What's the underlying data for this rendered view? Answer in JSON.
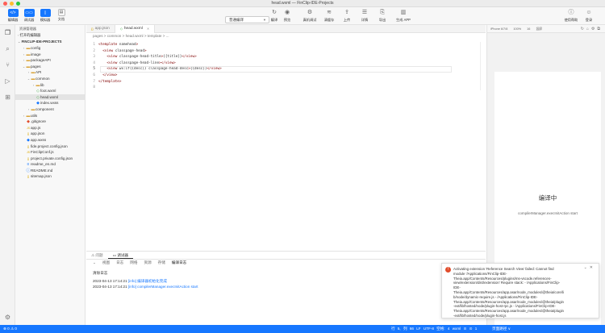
{
  "window": {
    "title": "head.wxml — FinClip-IDE-Projects"
  },
  "toolbar": {
    "left": [
      {
        "label": "编辑器",
        "icon": "</>"
      },
      {
        "label": "调试器",
        "icon": "▭▭"
      },
      {
        "label": "模拟器",
        "icon": "▯"
      },
      {
        "label": "文档",
        "icon": "▤"
      }
    ],
    "mode_select": "普通编译",
    "center": [
      {
        "label": "编译",
        "icon": "↻"
      },
      {
        "label": "预览",
        "icon": "◉"
      },
      {
        "label": "真机调试",
        "icon": "⚙"
      },
      {
        "label": "清缓存",
        "icon": "≋"
      },
      {
        "label": "上传",
        "icon": "⇪"
      },
      {
        "label": "详情",
        "icon": "☰"
      },
      {
        "label": "导出",
        "icon": "⎘"
      },
      {
        "label": "生成 APP",
        "icon": "▥"
      }
    ],
    "right": [
      {
        "label": "使用帮助",
        "icon": "ⓘ"
      },
      {
        "label": "登录",
        "icon": "☺"
      }
    ]
  },
  "explorer": {
    "title": "资源管理器",
    "open_editors": "打开的编辑器",
    "project": "FINCLIP-IDE-PROJECTS",
    "items": [
      {
        "label": "config",
        "depth": 1,
        "kind": "folder",
        "open": false
      },
      {
        "label": "image",
        "depth": 1,
        "kind": "folder",
        "open": false
      },
      {
        "label": "packageAPI",
        "depth": 1,
        "kind": "folder",
        "open": false
      },
      {
        "label": "pages",
        "depth": 1,
        "kind": "folder",
        "open": true
      },
      {
        "label": "API",
        "depth": 2,
        "kind": "folder",
        "open": false
      },
      {
        "label": "common",
        "depth": 2,
        "kind": "folder",
        "open": true
      },
      {
        "label": "lib",
        "depth": 3,
        "kind": "folder",
        "open": false
      },
      {
        "label": "foot.wxml",
        "depth": 3,
        "kind": "wxml"
      },
      {
        "label": "head.wxml",
        "depth": 3,
        "kind": "wxml"
      },
      {
        "label": "index.wxss",
        "depth": 3,
        "kind": "wxss"
      },
      {
        "label": "component",
        "depth": 2,
        "kind": "folder",
        "open": false
      },
      {
        "label": "utils",
        "depth": 1,
        "kind": "folder",
        "open": false
      },
      {
        "label": ".gitignore",
        "depth": 1,
        "kind": "git"
      },
      {
        "label": "app.js",
        "depth": 1,
        "kind": "js"
      },
      {
        "label": "app.json",
        "depth": 1,
        "kind": "json"
      },
      {
        "label": "app.wxss",
        "depth": 1,
        "kind": "wxss"
      },
      {
        "label": "fide.project.config.json",
        "depth": 1,
        "kind": "json"
      },
      {
        "label": "FinClipConf.js",
        "depth": 1,
        "kind": "js"
      },
      {
        "label": "project.private.config.json",
        "depth": 1,
        "kind": "json"
      },
      {
        "label": "readme_en.md",
        "depth": 1,
        "kind": "md"
      },
      {
        "label": "README.md",
        "depth": 1,
        "kind": "info"
      },
      {
        "label": "sitemap.json",
        "depth": 1,
        "kind": "json"
      }
    ]
  },
  "tabs": [
    {
      "label": "app.json",
      "active": false
    },
    {
      "label": "head.wxml",
      "active": true
    }
  ],
  "breadcrumb": "pages  >  common  >  head.wxml  >  template  >  ...",
  "code_lines": [
    "<template name=\"head\">",
    "  <view class=\"page-head\">",
    "    <view class=\"page-head-title\">{{title}}</view>",
    "    <view class=\"page-head-line\"></view>",
    "    <view wx:if=\"{{desc}}\" class=\"page-head-desc\">{{desc}}</view>",
    "  </view>",
    "</template>",
    ""
  ],
  "preview": {
    "device": "iPhone 6/7/8",
    "zoom": "100%",
    "scale": "16",
    "mode": "竖屏",
    "compiling": "编译中",
    "compiling_sub": "compilerManager.execInitAction start"
  },
  "panel": {
    "tabs": [
      "问题",
      "调试器"
    ],
    "subtabs": [
      "视图",
      "日志",
      "网络",
      "资源",
      "存储",
      "编译日志"
    ],
    "active_subtab": "编译日志",
    "log_title": "清除日志",
    "logs": [
      {
        "time": "2023-04-13 17:14:21",
        "text": " [info] 编译器初始化完成"
      },
      {
        "time": "2023-04-13 17:14:21",
        "text": " [info] compilerManager.execInitAction start"
      }
    ]
  },
  "toast": {
    "message": [
      "Activating extension 'Reference Search View' failed: Cannot find",
      "module '/Applications/FinClip-IDE-",
      "Theia.app/Contents/Resources/plugins/ms-vscode.references-",
      "view/extension/dist/extension' Require stack: - /Applications/FinClip-",
      "IDE-",
      "Theia.app/Contents/Resources/app.asar/node_modules/@theia/core/li",
      "b/node/dynamic-require.js - /Applications/FinClip-IDE-",
      "Theia.app/Contents/Resources/app.asar/node_modules/@theia/plugin",
      "-ext/lib/hosted/node/plugin-host-rpc.js - /Applications/FinClip-IDE-",
      "Theia.app/Contents/Resources/app.asar/node_modules/@theia/plugin",
      "-ext/lib/hosted/node/plugin-host.js"
    ]
  },
  "statusbar": {
    "left": "⊗ 0 ⚠ 0",
    "right": "行 5, 列 66   LF   UTF-8   空格: 4   wxml   ⊙ ⊙ 1",
    "preview": "页面路径 ∨"
  },
  "colors": {
    "accent": "#1677ff",
    "statusbar": "#1677ff",
    "error": "#e14c2b"
  }
}
